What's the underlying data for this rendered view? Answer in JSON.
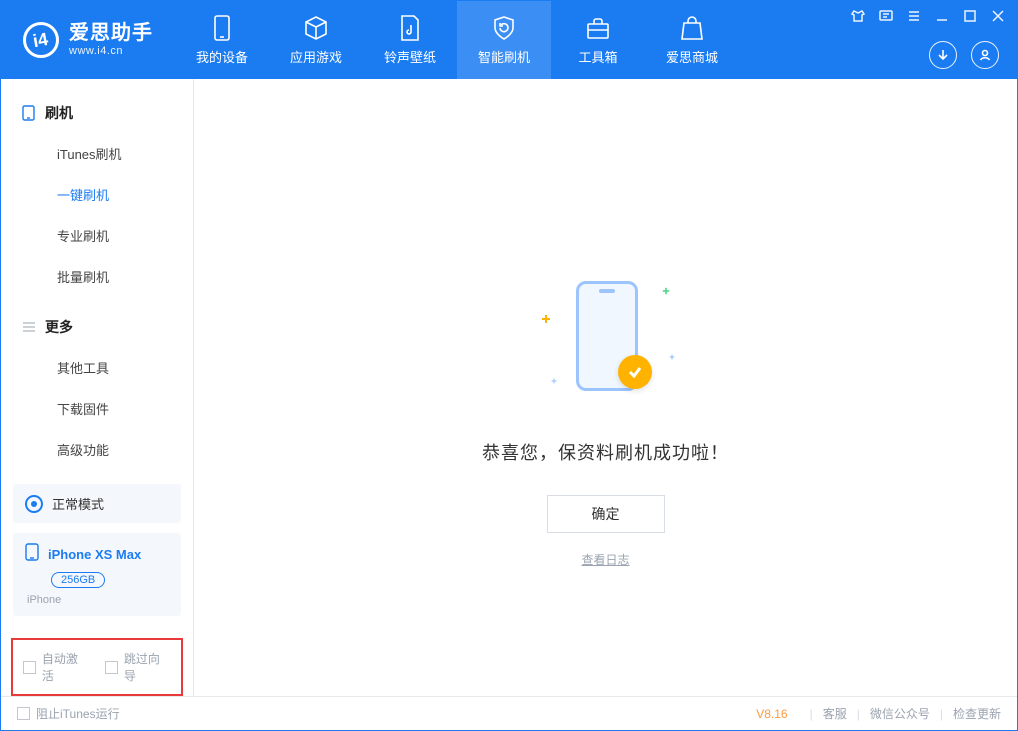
{
  "app": {
    "title": "爱思助手",
    "subtitle": "www.i4.cn"
  },
  "tabs": {
    "device": "我的设备",
    "apps": "应用游戏",
    "ringtone": "铃声壁纸",
    "flash": "智能刷机",
    "toolbox": "工具箱",
    "store": "爱思商城"
  },
  "sidebar": {
    "group1_title": "刷机",
    "group1_items": [
      "iTunes刷机",
      "一键刷机",
      "专业刷机",
      "批量刷机"
    ],
    "group2_title": "更多",
    "group2_items": [
      "其他工具",
      "下载固件",
      "高级功能"
    ]
  },
  "device": {
    "mode": "正常模式",
    "name": "iPhone XS Max",
    "capacity": "256GB",
    "type": "iPhone"
  },
  "checks": {
    "auto_activate": "自动激活",
    "skip_guide": "跳过向导"
  },
  "main": {
    "success": "恭喜您，保资料刷机成功啦！",
    "ok": "确定",
    "view_log": "查看日志"
  },
  "footer": {
    "block_itunes": "阻止iTunes运行",
    "version": "V8.16",
    "links": [
      "客服",
      "微信公众号",
      "检查更新"
    ]
  }
}
